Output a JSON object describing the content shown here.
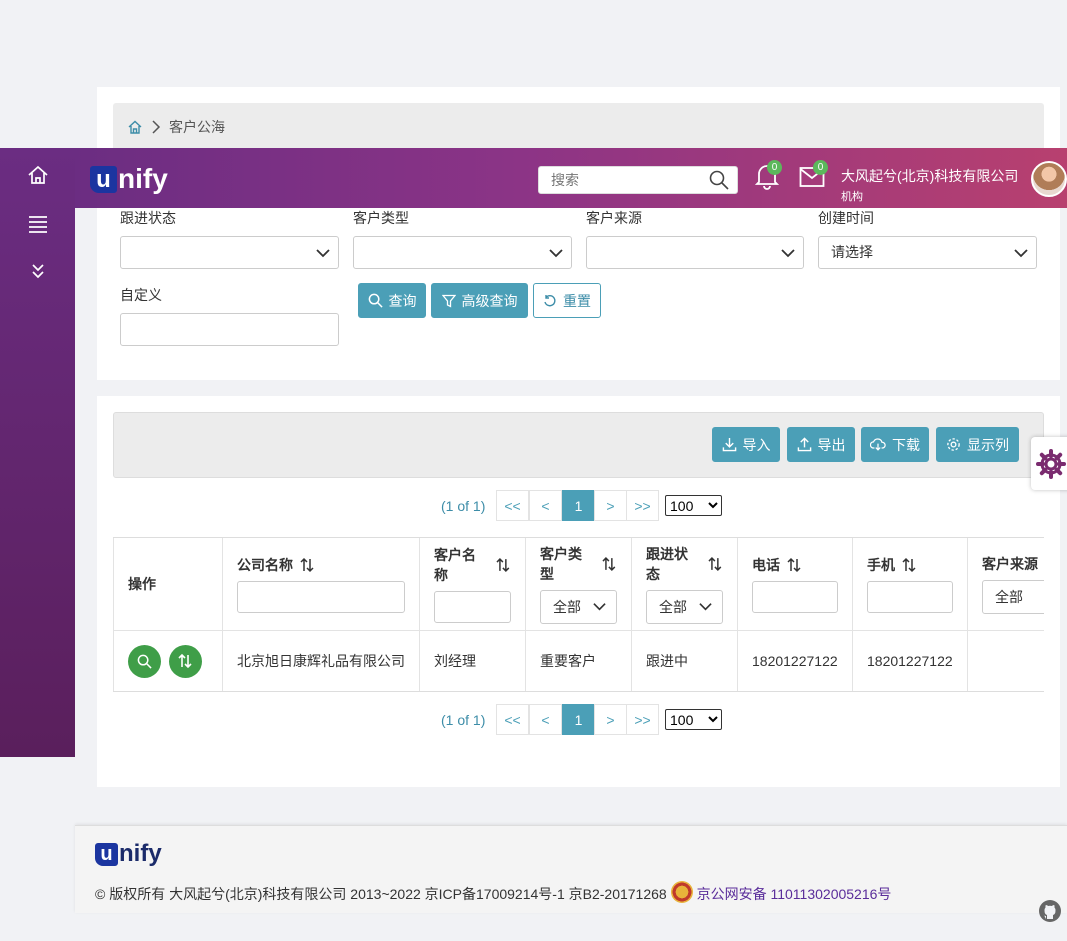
{
  "breadcrumb": {
    "current": "客户公海"
  },
  "header": {
    "search_placeholder": "搜索",
    "notifications_count": "0",
    "messages_count": "0",
    "company_name": "大风起兮(北京)科技有限公司",
    "role": "机构"
  },
  "logo": {
    "u": "u",
    "rest": "nify"
  },
  "filters": {
    "follow_status": {
      "label": "跟进状态",
      "value": ""
    },
    "customer_type": {
      "label": "客户类型",
      "value": ""
    },
    "customer_source": {
      "label": "客户来源",
      "value": ""
    },
    "created_time": {
      "label": "创建时间",
      "value": "请选择"
    },
    "custom": {
      "label": "自定义",
      "value": ""
    }
  },
  "actions": {
    "query": "查询",
    "advanced_query": "高级查询",
    "reset": "重置"
  },
  "toolbar": {
    "import": "导入",
    "export": "导出",
    "download": "下载",
    "columns": "显示列"
  },
  "pager": {
    "info": "(1 of 1)",
    "first": "<<",
    "prev": "<",
    "current": "1",
    "next": ">",
    "last": ">>",
    "per_page": "100"
  },
  "table": {
    "headers": {
      "ops": "操作",
      "company": "公司名称",
      "customer": "客户名称",
      "type": "客户类型",
      "status": "跟进状态",
      "phone": "电话",
      "mobile": "手机",
      "source": "客户来源"
    },
    "filter_all": "全部",
    "rows": [
      {
        "company": "北京旭日康辉礼品有限公司",
        "customer": "刘经理",
        "type": "重要客户",
        "status": "跟进中",
        "phone": "18201227122",
        "mobile": "18201227122",
        "source": ""
      }
    ]
  },
  "footer": {
    "copyright": "© 版权所有 大风起兮(北京)科技有限公司 2013~2022 京ICP备17009214号-1 京B2-20171268",
    "police": "京公网安备 11011302005216号"
  }
}
